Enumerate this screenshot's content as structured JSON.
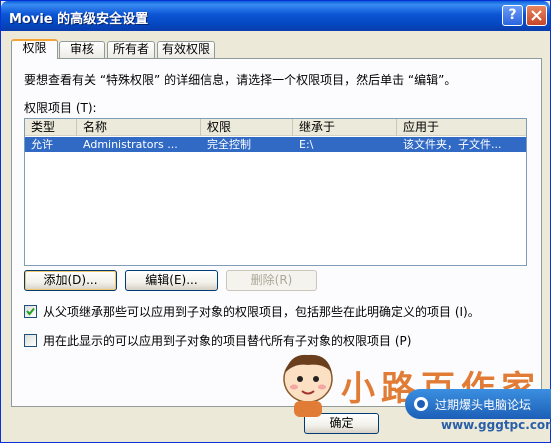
{
  "window": {
    "title": "Movie 的高级安全设置"
  },
  "tabs": [
    {
      "label": "权限"
    },
    {
      "label": "审核"
    },
    {
      "label": "所有者"
    },
    {
      "label": "有效权限"
    }
  ],
  "panel": {
    "description": "要想查看有关 “特殊权限” 的详细信息，请选择一个权限项目，然后单击 “编辑”。",
    "list_label": "权限项目 (T):"
  },
  "table": {
    "columns": [
      "类型",
      "名称",
      "权限",
      "继承于",
      "应用于"
    ],
    "rows": [
      {
        "type": "允许",
        "name": "Administrators ...",
        "permission": "完全控制",
        "inherited_from": "E:\\",
        "applies_to": "该文件夹，子文件..."
      }
    ]
  },
  "buttons": {
    "add": "添加(D)...",
    "edit": "编辑(E)...",
    "remove": "删除(R)",
    "ok": "确定"
  },
  "checkboxes": {
    "inherit": {
      "label": "从父项继承那些可以应用到子对象的权限项目，包括那些在此明确定义的项目 (I)。",
      "checked": true
    },
    "replace": {
      "label": "用在此显示的可以应用到子对象的项目替代所有子对象的权限项目 (P)",
      "checked": false
    }
  },
  "watermark": {
    "text": "小路百作家",
    "badge": "过期爆头电脑论坛",
    "url": "www.gggtpc.com"
  },
  "colors": {
    "titlebar": "#0b55d4",
    "selection": "#316ac5",
    "tab_highlight": "#f4a335",
    "watermark": "#e07c35"
  }
}
